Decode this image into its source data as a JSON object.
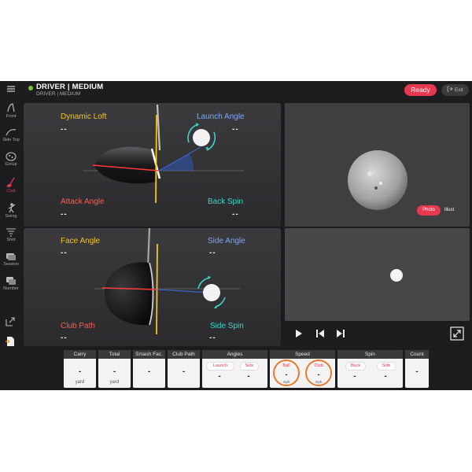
{
  "header": {
    "title": "DRIVER | MEDIUM",
    "subtitle": "DRIVER | MEDIUM",
    "ready_label": "Ready",
    "exit_label": "Exit",
    "status_color": "#7bc043",
    "accent_color": "#e8384f"
  },
  "sidebar": {
    "items": [
      {
        "label": "Front",
        "icon": "front-view-icon"
      },
      {
        "label": "Side Top",
        "icon": "side-top-view-icon"
      },
      {
        "label": "Group",
        "icon": "group-icon"
      },
      {
        "label": "Club",
        "icon": "club-icon",
        "active": true
      },
      {
        "label": "Swing",
        "icon": "swing-icon"
      },
      {
        "label": "Shot",
        "icon": "shot-icon"
      },
      {
        "label": "Session",
        "icon": "session-icon"
      },
      {
        "label": "Number",
        "icon": "number-icon"
      }
    ],
    "bottom_icons": [
      "export-icon",
      "document-icon",
      "report-icon",
      "settings-icon"
    ]
  },
  "club_top": {
    "dynamic_loft_label": "Dynamic Loft",
    "dynamic_loft_value": "--",
    "launch_angle_label": "Launch Angle",
    "launch_angle_value": "--",
    "attack_angle_label": "Attack Angle",
    "attack_angle_value": "--",
    "back_spin_label": "Back Spin",
    "back_spin_value": "--"
  },
  "club_bottom": {
    "face_angle_label": "Face Angle",
    "face_angle_value": "--",
    "side_angle_label": "Side Angle",
    "side_angle_value": "--",
    "club_path_label": "Club Path",
    "club_path_value": "--",
    "side_spin_label": "Side Spin",
    "side_spin_value": "--"
  },
  "camera": {
    "photo_label": "Photo",
    "illust_label": "Illust",
    "controls": [
      "play-icon",
      "step-back-icon",
      "step-forward-icon"
    ],
    "expand_icon": "expand-icon"
  },
  "stats": {
    "carry": {
      "label": "Carry",
      "value": "-",
      "unit": "yard"
    },
    "total": {
      "label": "Total",
      "value": "-",
      "unit": "yard"
    },
    "smash": {
      "label": "Smash Fac.",
      "value": "-"
    },
    "club_path": {
      "label": "Club Path",
      "value": "-"
    },
    "angles": {
      "label": "Angles",
      "launch_label": "Launch",
      "launch_value": "-",
      "side_label": "Side",
      "side_value": "-"
    },
    "speed": {
      "label": "Speed",
      "ball_label": "Ball",
      "ball_value": "-",
      "ball_unit": "mph",
      "club_label": "Club",
      "club_value": "-",
      "club_unit": "mph"
    },
    "spin": {
      "label": "Spin",
      "back_label": "Back",
      "back_value": "-",
      "side_label": "Side",
      "side_value": "-"
    },
    "count": {
      "label": "Count",
      "value": "-"
    }
  }
}
